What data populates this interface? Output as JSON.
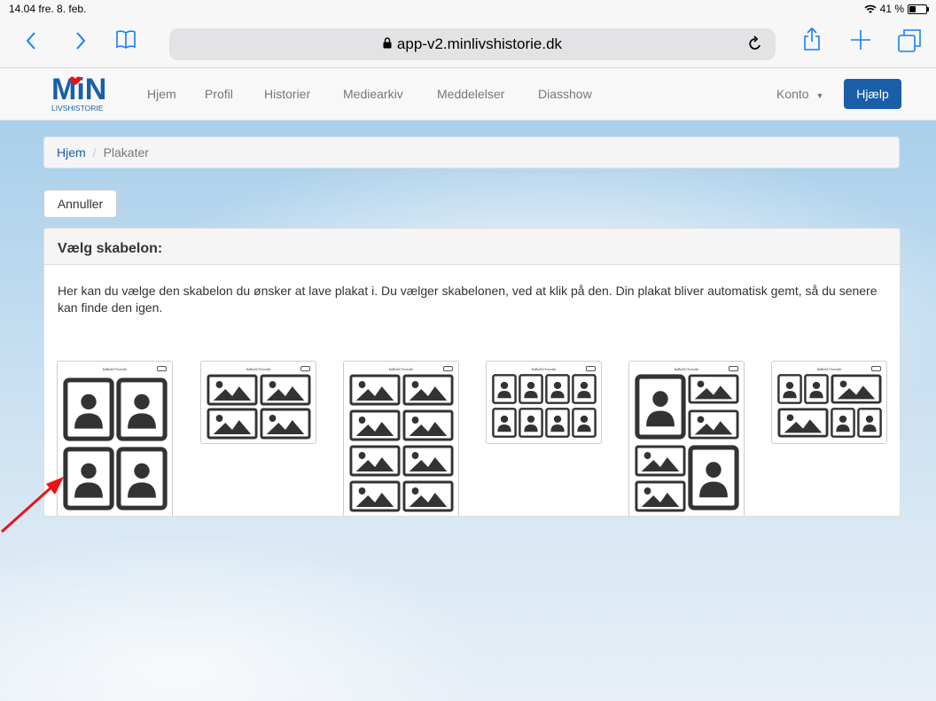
{
  "status": {
    "time": "14.04  fre. 8. feb.",
    "battery": "41 %",
    "battery_level": 0.41
  },
  "browser": {
    "url": "app-v2.minlivshistorie.dk"
  },
  "site": {
    "logo_text": "MiN",
    "logo_sub": "LIVSHISTORIE",
    "nav": [
      "Hjem",
      "Profil",
      "Historier",
      "Mediearkiv",
      "Meddelelser",
      "Diasshow"
    ],
    "account": "Konto",
    "help": "Hjælp"
  },
  "breadcrumb": {
    "home": "Hjem",
    "separator": "/",
    "current": "Plakater"
  },
  "cancel_label": "Annuller",
  "panel": {
    "title": "Vælg skabelon:",
    "description": "Her kan du vælge den skabelon du ønsker at lave plakat i. Du vælger skabelonen, ved at klik på den. Din plakat bliver automatisk gemt, så du senere kan finde den igen."
  },
  "templates": [
    {
      "header": "Indhold Oversikt",
      "slots": [
        "person",
        "person",
        "person",
        "person"
      ]
    },
    {
      "header": "Indhold Oversikt",
      "slots": [
        "image",
        "image",
        "image",
        "image"
      ]
    },
    {
      "header": "Indhold Oversikt",
      "slots": [
        "image",
        "image",
        "image",
        "image",
        "image",
        "image",
        "image",
        "image"
      ]
    },
    {
      "header": "Indhold Oversikt",
      "slots": [
        "person",
        "person",
        "person",
        "person",
        "person",
        "person",
        "person",
        "person"
      ]
    },
    {
      "header": "Indhold Oversikt",
      "slots": [
        "person",
        "image",
        "image",
        "image",
        "person",
        "image"
      ]
    },
    {
      "header": "Indhold Oversikt",
      "slots": [
        "person",
        "person",
        "image",
        "image",
        "person",
        "person"
      ]
    }
  ],
  "colors": {
    "brand_blue": "#1a5ea8",
    "ios_blue": "#157efb",
    "annotation_arrow": "#e8141a"
  }
}
